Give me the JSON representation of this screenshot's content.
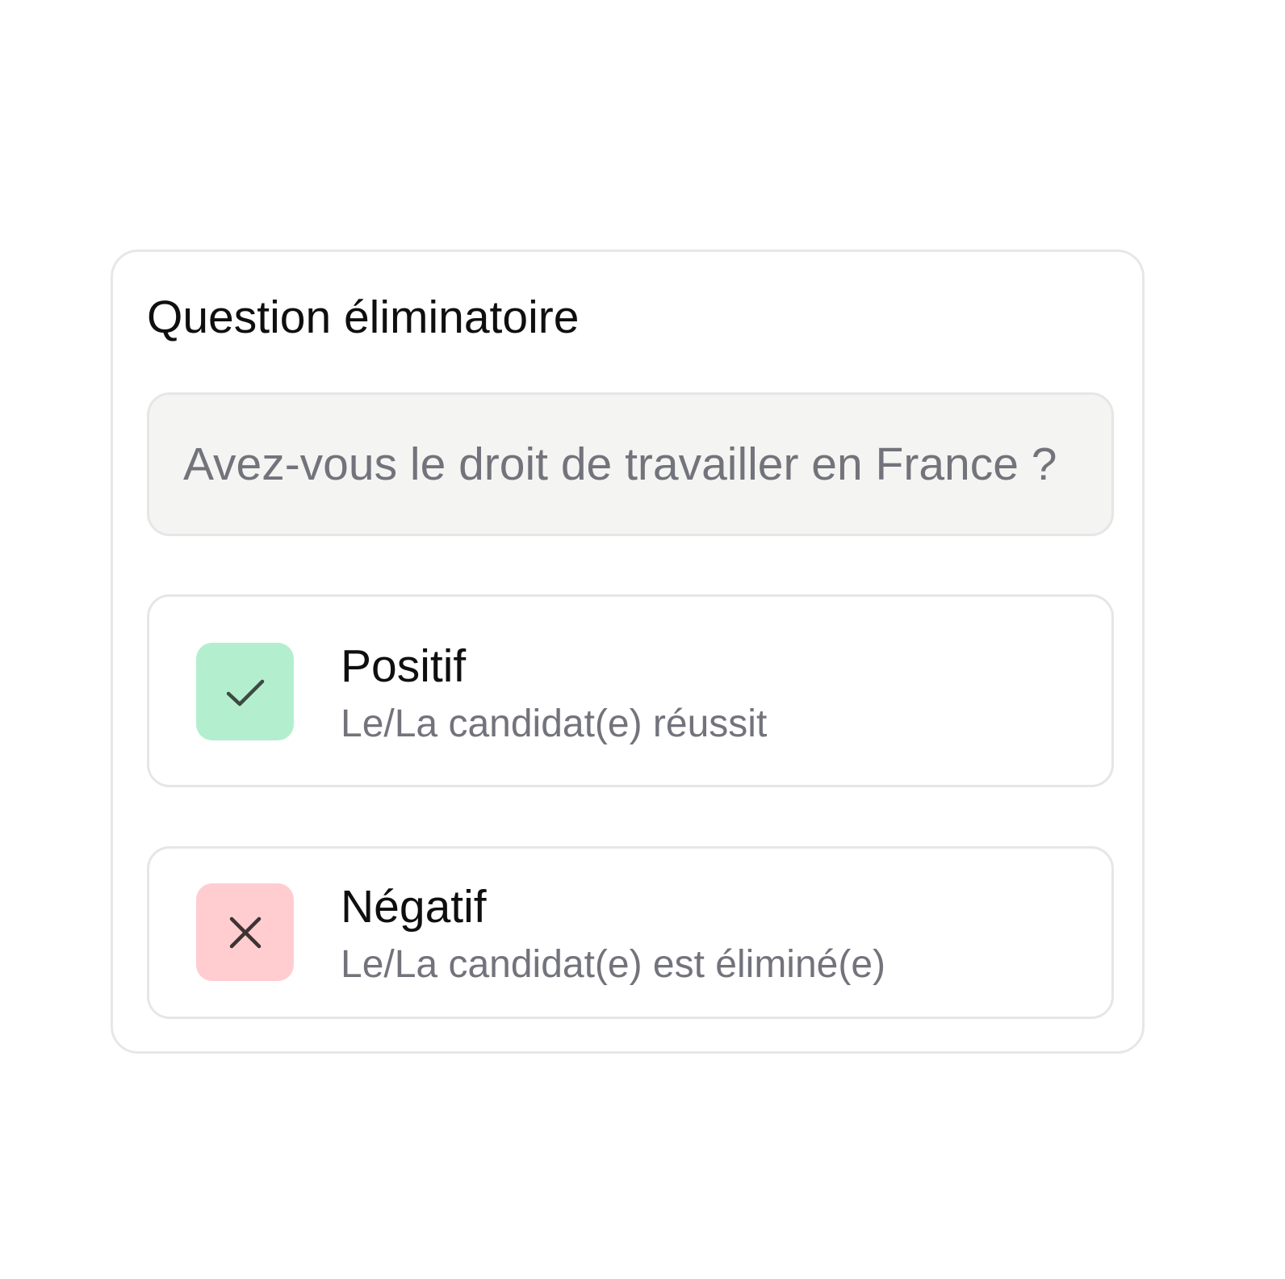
{
  "card": {
    "title": "Question éliminatoire",
    "question_value": "Avez-vous le droit de travailler en France ?"
  },
  "options": [
    {
      "label": "Positif",
      "description": "Le/La candidat(e) réussit",
      "icon": "check-icon",
      "badge_color": "#b3efcf"
    },
    {
      "label": "Négatif",
      "description": "Le/La candidat(e) est éliminé(e)",
      "icon": "close-icon",
      "badge_color": "#ffcdd0"
    }
  ]
}
